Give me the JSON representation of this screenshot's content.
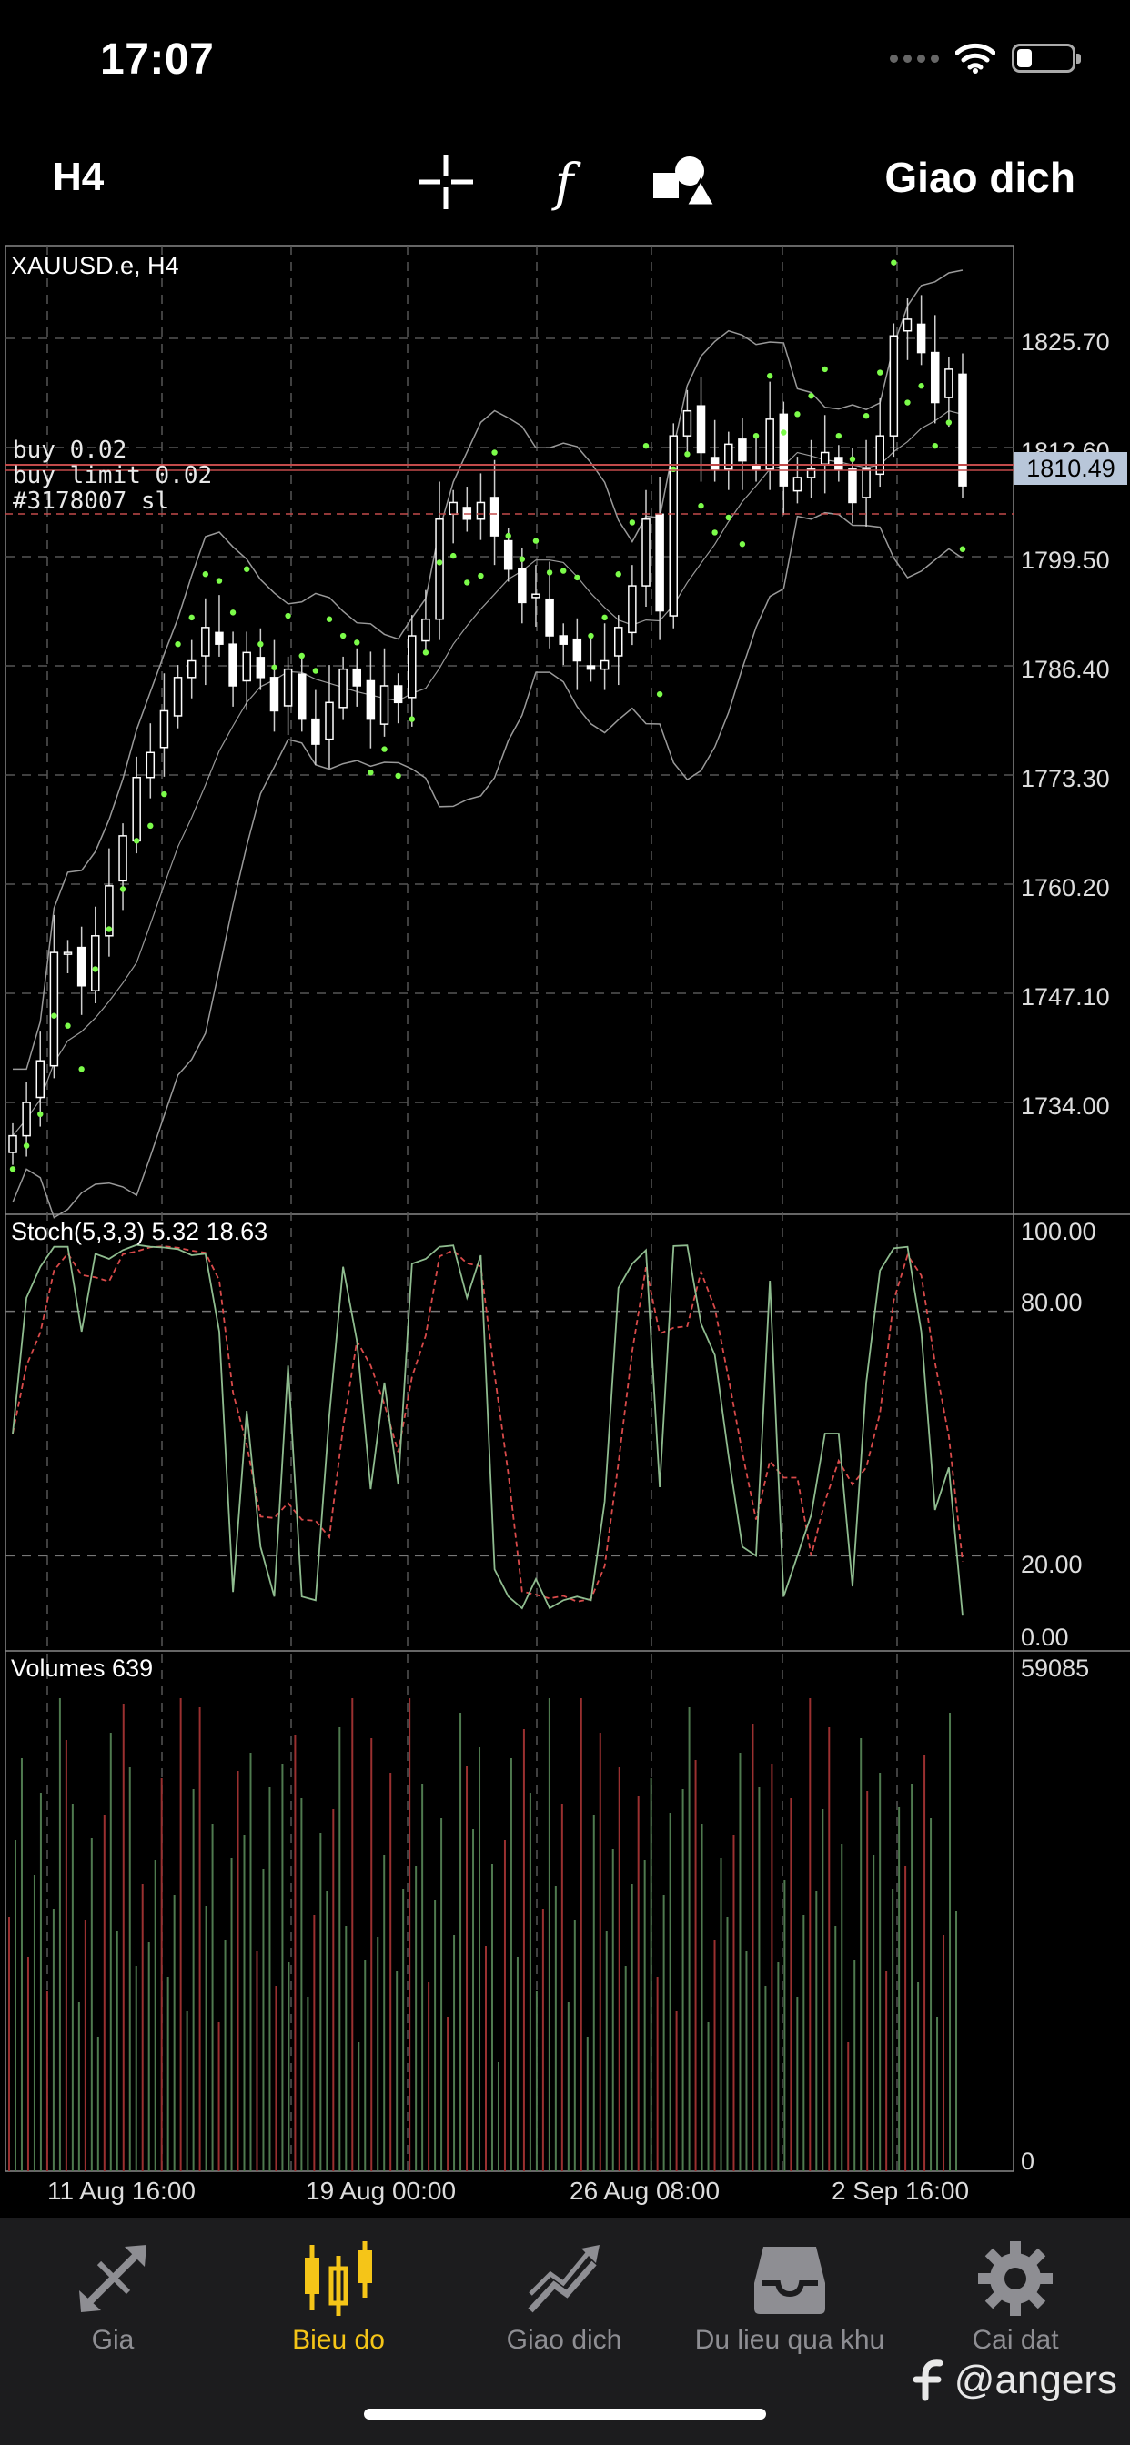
{
  "status_bar": {
    "time": "17:07"
  },
  "toolbar": {
    "period": "H4",
    "crosshair_icon": "crosshair-icon",
    "indicator_icon": "function-icon",
    "objects_icon": "shapes-icon",
    "trade_label": "Giao dich"
  },
  "chart": {
    "symbol_label": "XAUUSD.e, H4",
    "orders": [
      "buy 0.02",
      "buy limit 0.02",
      "#3178007 sl"
    ],
    "current_price": "1810.49",
    "price_ticks": [
      "1825.70",
      "1812.60",
      "1799.50",
      "1786.40",
      "1773.30",
      "1760.20",
      "1747.10",
      "1734.00"
    ],
    "stoch_label": "Stoch(5,3,3) 5.32 18.63",
    "stoch_ticks": [
      "100.00",
      "80.00",
      "20.00",
      "0.00"
    ],
    "volume_label": "Volumes 639",
    "volume_ticks": [
      "59085",
      "0"
    ],
    "time_ticks": [
      "11 Aug 16:00",
      "19 Aug 00:00",
      "26 Aug 08:00",
      "2 Sep 16:00"
    ],
    "colors": {
      "bull": "#ffffff",
      "bear": "#ffffff",
      "sar": "#7cfc4a",
      "band": "#9a9a9a",
      "stoch_main": "#8fbc8f",
      "stoch_signal": "#d94a4a",
      "vol_up": "#4f7a4f",
      "vol_down": "#9a3030",
      "order_line": "#c24a4a"
    }
  },
  "chart_data": {
    "type": "candlestick",
    "instrument": "XAUUSD.e",
    "timeframe": "H4",
    "price_range": [
      1729.0,
      1832.0
    ],
    "close_series": [
      1730,
      1734,
      1739,
      1752,
      1752,
      1748,
      1754,
      1760,
      1766,
      1773,
      1776,
      1781,
      1785,
      1787,
      1791,
      1789,
      1784,
      1788,
      1785,
      1781,
      1786,
      1780,
      1777,
      1782,
      1786,
      1784,
      1780,
      1784,
      1782,
      1790,
      1792,
      1804,
      1806,
      1804,
      1806,
      1802,
      1798,
      1794,
      1795,
      1790,
      1789,
      1787,
      1786,
      1787,
      1791,
      1796,
      1804,
      1793,
      1814,
      1817,
      1812,
      1810,
      1813,
      1811,
      1810,
      1816,
      1808,
      1809,
      1810,
      1812,
      1810,
      1806,
      1810,
      1814,
      1826,
      1828,
      1824,
      1818,
      1822,
      1808
    ],
    "stochastic": {
      "params": "5,3,3",
      "main": 5.32,
      "signal": 18.63,
      "range": [
        0,
        100
      ],
      "levels": [
        20,
        80
      ]
    },
    "volume": {
      "last": 639,
      "max": 59085
    }
  },
  "bottom_nav": {
    "items": [
      {
        "label": "Gia",
        "icon": "quotes-arrows-icon",
        "active": false
      },
      {
        "label": "Bieu do",
        "icon": "candlestick-chart-icon",
        "active": true
      },
      {
        "label": "Giao dich",
        "icon": "trade-chart-icon",
        "active": false
      },
      {
        "label": "Du lieu qua khu",
        "icon": "history-inbox-icon",
        "active": false
      },
      {
        "label": "Cai dat",
        "icon": "gear-icon",
        "active": false
      }
    ]
  },
  "watermark": "@angers"
}
